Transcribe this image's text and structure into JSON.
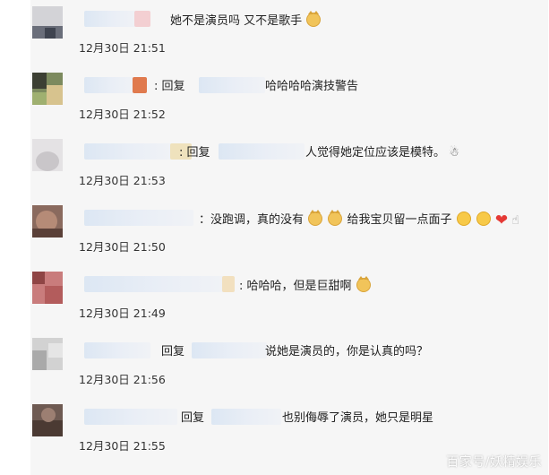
{
  "comments": [
    {
      "text": "她不是演员吗 又不是歌手",
      "time": "12月30日 21:51"
    },
    {
      "prefix": ": 回复",
      "text": "哈哈哈哈演技警告",
      "time": "12月30日 21:52"
    },
    {
      "prefix": ": 回复",
      "text": "人觉得她定位应该是模特。",
      "time": "12月30日 21:53"
    },
    {
      "prefix": "：没跑调，真的没有",
      "text": "给我宝贝留一点面子",
      "time": "12月30日 21:50"
    },
    {
      "text": ": 哈哈哈，但是巨甜啊",
      "time": "12月30日 21:49"
    },
    {
      "prefix": "回复",
      "text": "说她是演员的，你是认真的吗？",
      "time": "12月30日 21:56"
    },
    {
      "prefix": "回复",
      "text": "也别侮辱了演员，她只是明星",
      "time": "12月30日 21:55"
    }
  ],
  "watermark": "百家号/妖精娱乐",
  "icons": [
    "cat-emoji-icon",
    "smile-emoji-icon",
    "heart-icon",
    "hand-icon",
    "ghost-icon"
  ]
}
